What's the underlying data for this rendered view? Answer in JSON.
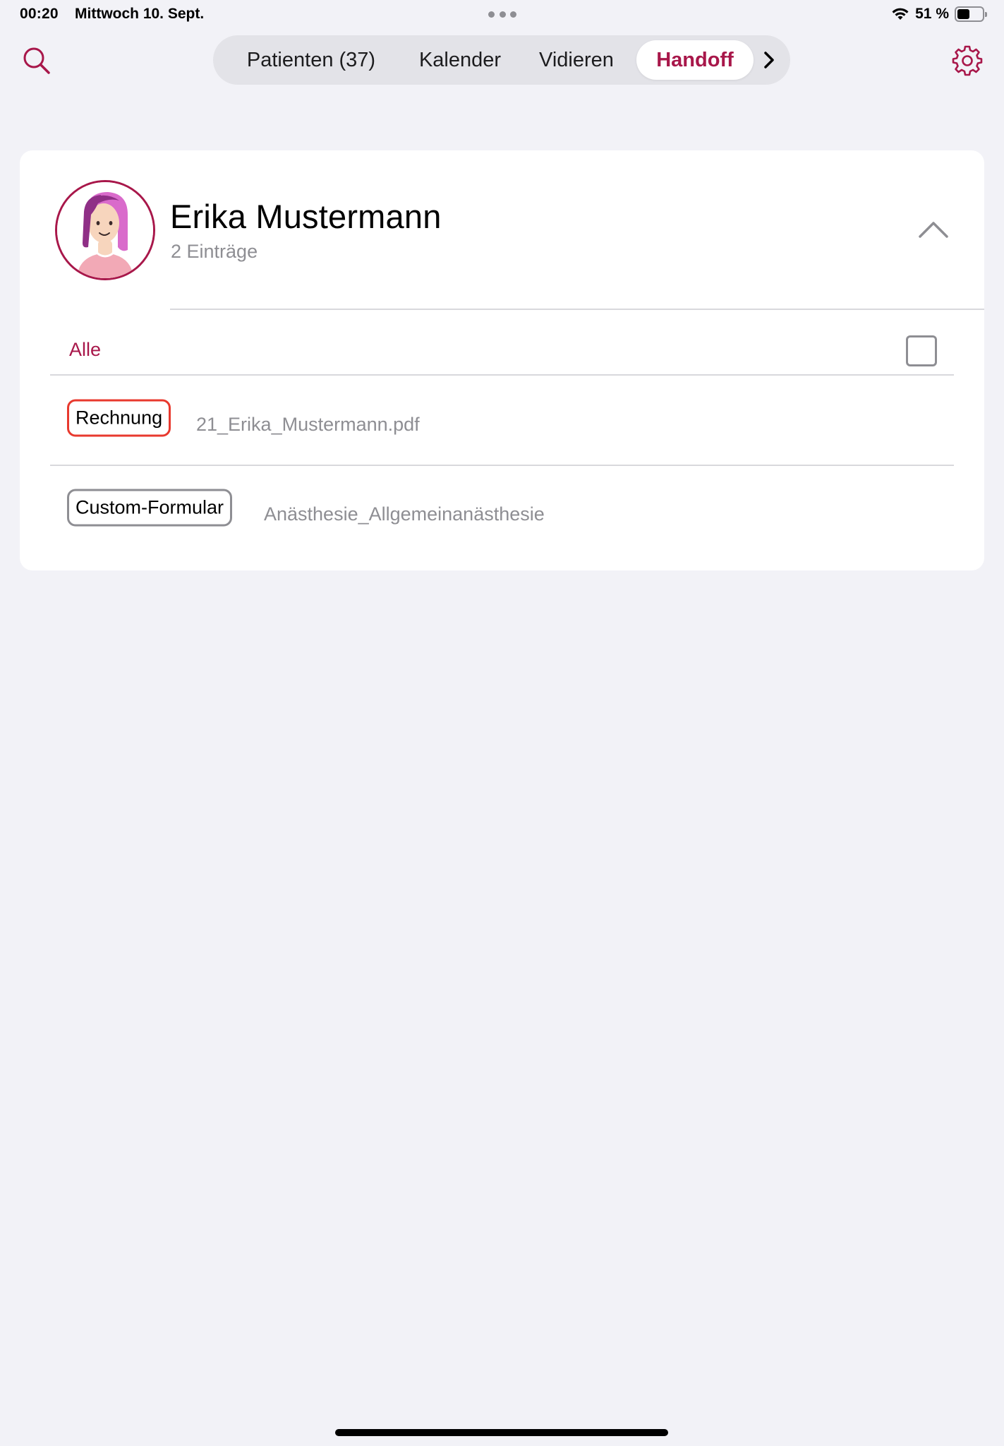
{
  "status_bar": {
    "time": "00:20",
    "date": "Mittwoch 10. Sept.",
    "battery_text": "51 %",
    "battery_level": 0.51
  },
  "nav": {
    "tabs": [
      {
        "label": "Patienten (37)",
        "active": false
      },
      {
        "label": "Kalender",
        "active": false
      },
      {
        "label": "Vidieren",
        "active": false
      },
      {
        "label": "Handoff",
        "active": true
      }
    ],
    "icons": {
      "search": "search-icon",
      "settings": "gear-icon",
      "more": "chevron-right-icon"
    }
  },
  "patient": {
    "name": "Erika Mustermann",
    "entries_label": "2 Einträge",
    "select_all_label": "Alle",
    "select_all_checked": false,
    "items": [
      {
        "tag": "Rechnung",
        "file": "21_Erika_Mustermann.pdf",
        "tag_color": "#e8392e"
      },
      {
        "tag": "Custom-Formular",
        "file": "Anästhesie_Allgemeinanästhesie",
        "tag_color": "#8e8e93"
      }
    ]
  },
  "colors": {
    "accent": "#a8174a",
    "background": "#f2f2f7",
    "secondary_text": "#8e8e93"
  }
}
